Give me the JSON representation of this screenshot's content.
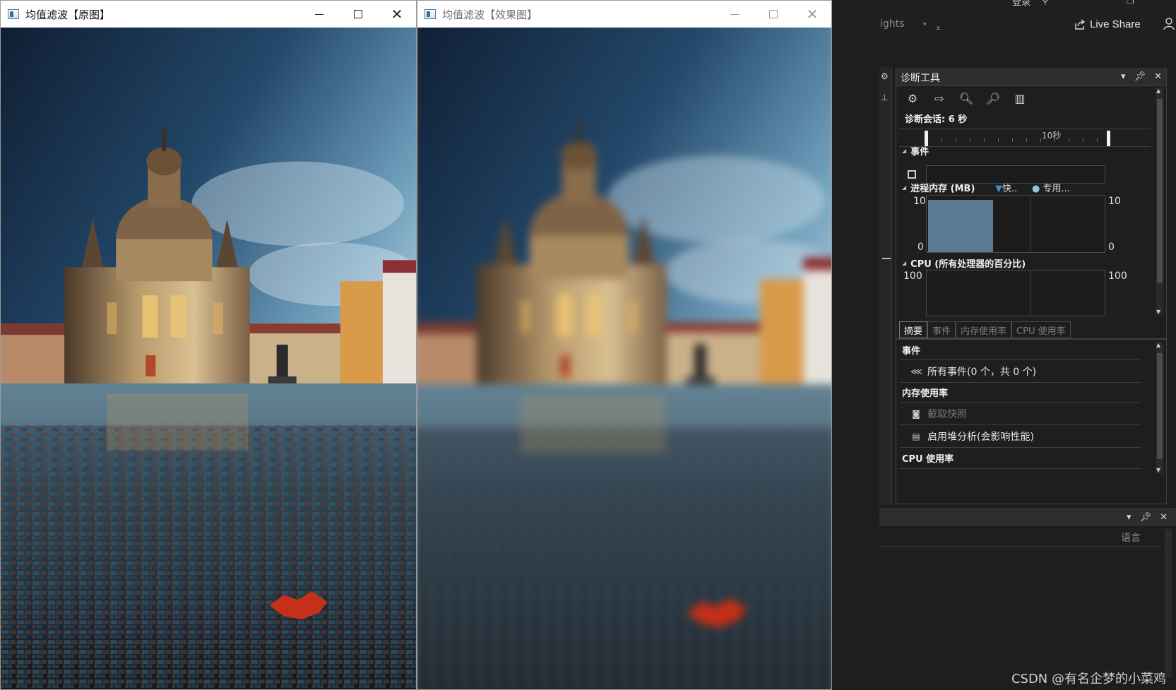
{
  "windows": {
    "original": {
      "title": "均值滤波【原图】"
    },
    "result": {
      "title": "均值滤波【效果图】"
    }
  },
  "vs": {
    "insights": "ights",
    "login": "登录",
    "live_share": "Live Share",
    "diag": {
      "title": "诊断工具",
      "session": "诊断会话: 6 秒",
      "timeline_label": "10秒",
      "events_header": "事件",
      "memory_header": "进程内存 (MB)",
      "legend_snapshot": "快..",
      "legend_private": "专用...",
      "mem_max_left": "10",
      "mem_min_left": "0",
      "mem_max_right": "10",
      "mem_min_right": "0",
      "cpu_header": "CPU (所有处理器的百分比)",
      "cpu_max_left": "100",
      "cpu_max_right": "100",
      "tabs": [
        "摘要",
        "事件",
        "内存使用率",
        "CPU 使用率"
      ],
      "summary": {
        "events_h": "事件",
        "all_events": "所有事件(0 个，共 0 个)",
        "memory_h": "内存使用率",
        "snapshot": "截取快照",
        "heap": "启用堆分析(会影响性能)",
        "cpu_h": "CPU 使用率"
      },
      "colors": {
        "memory_fill": "#5b7a93",
        "legend_snapshot": "#3c8fd6",
        "legend_private": "#8ec4e8"
      }
    },
    "output": {
      "lang": "语言"
    },
    "watermark": "CSDN @有名企梦的小菜鸡"
  }
}
